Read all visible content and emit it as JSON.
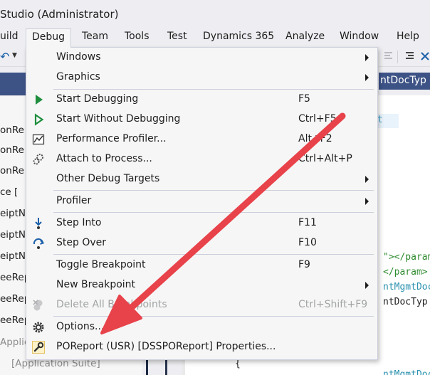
{
  "window": {
    "title": "Studio (Administrator)"
  },
  "menubar": {
    "items": [
      {
        "label": "uild"
      },
      {
        "label": "Debug"
      },
      {
        "label": "Team"
      },
      {
        "label": "Tools"
      },
      {
        "label": "Test"
      },
      {
        "label": "Dynamics 365"
      },
      {
        "label": "Analyze"
      },
      {
        "label": "Window"
      },
      {
        "label": "Help"
      }
    ]
  },
  "tabs": {
    "active_tab": "ntDocTyp"
  },
  "tree": {
    "rows": [
      "onRe",
      "onRe",
      "onRe",
      "ce  [",
      "eiptN",
      "eiptN",
      "eiptN",
      "eeRep",
      "eeRep",
      "eeRep",
      "Applic",
      "[Application Suite]"
    ]
  },
  "editor": {
    "ext_label": "xt",
    "lines": {
      "l1_green": "\"></param",
      "l2_green": "</param>",
      "l3_teal": "ntMgmtDoc",
      "l4_dark": "ntDocTyp",
      "l5_teal": "ntMgmtDocT"
    },
    "brace": "{"
  },
  "debug_menu": {
    "items": [
      {
        "label": "Windows",
        "shortcut": "",
        "submenu": true,
        "icon": ""
      },
      {
        "label": "Graphics",
        "shortcut": "",
        "submenu": true,
        "icon": ""
      },
      {
        "label": "Start Debugging",
        "shortcut": "F5",
        "submenu": false,
        "icon": "play-icon"
      },
      {
        "label": "Start Without Debugging",
        "shortcut": "Ctrl+F5",
        "submenu": false,
        "icon": "play-outline-icon"
      },
      {
        "label": "Performance Profiler...",
        "shortcut": "Alt+F2",
        "submenu": false,
        "icon": "performance-icon"
      },
      {
        "label": "Attach to Process...",
        "shortcut": "Ctrl+Alt+P",
        "submenu": false,
        "icon": "gears-icon"
      },
      {
        "label": "Other Debug Targets",
        "shortcut": "",
        "submenu": true,
        "icon": ""
      },
      {
        "label": "Profiler",
        "shortcut": "",
        "submenu": true,
        "icon": ""
      },
      {
        "label": "Step Into",
        "shortcut": "F11",
        "submenu": false,
        "icon": "step-into-icon"
      },
      {
        "label": "Step Over",
        "shortcut": "F10",
        "submenu": false,
        "icon": "step-over-icon"
      },
      {
        "label": "Toggle Breakpoint",
        "shortcut": "F9",
        "submenu": false,
        "icon": ""
      },
      {
        "label": "New Breakpoint",
        "shortcut": "",
        "submenu": true,
        "icon": ""
      },
      {
        "label": "Delete All Breakpoints",
        "shortcut": "Ctrl+Shift+F9",
        "submenu": false,
        "icon": "delete-breakpoints-icon",
        "disabled": true
      },
      {
        "label": "Options...",
        "shortcut": "",
        "submenu": false,
        "icon": "gear-icon"
      },
      {
        "label": "POReport (USR) [DSSPOReport] Properties...",
        "shortcut": "",
        "submenu": false,
        "icon": "wrench-icon"
      }
    ]
  },
  "colors": {
    "accent_dark": "#3d5386",
    "annotation_arrow": "#e8424a",
    "play_green": "#1e8e3e"
  }
}
